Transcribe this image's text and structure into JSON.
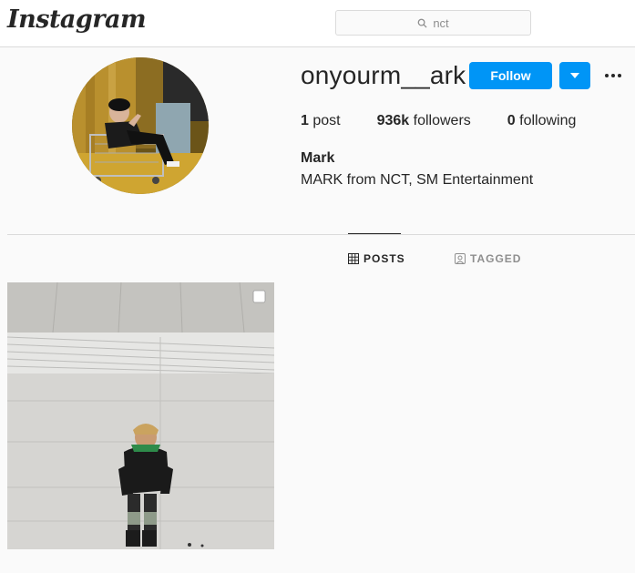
{
  "nav": {
    "logo": "Instagram",
    "search_value": "nct"
  },
  "profile": {
    "username": "onyourm__ark",
    "follow_label": "Follow",
    "posts_count": "1",
    "posts_label": " post",
    "followers_count": "936k",
    "followers_label": " followers",
    "following_count": "0",
    "following_label": " following",
    "full_name": "Mark",
    "bio": "MARK from NCT, SM Entertainment"
  },
  "tabs": [
    {
      "label": "POSTS",
      "active": true,
      "icon": "grid-icon"
    },
    {
      "label": "TAGGED",
      "active": false,
      "icon": "tagged-icon"
    }
  ],
  "colors": {
    "accent": "#0095f6",
    "border": "#dbdbdb",
    "background": "#fafafa",
    "text": "#262626",
    "muted": "#8e8e8e"
  }
}
